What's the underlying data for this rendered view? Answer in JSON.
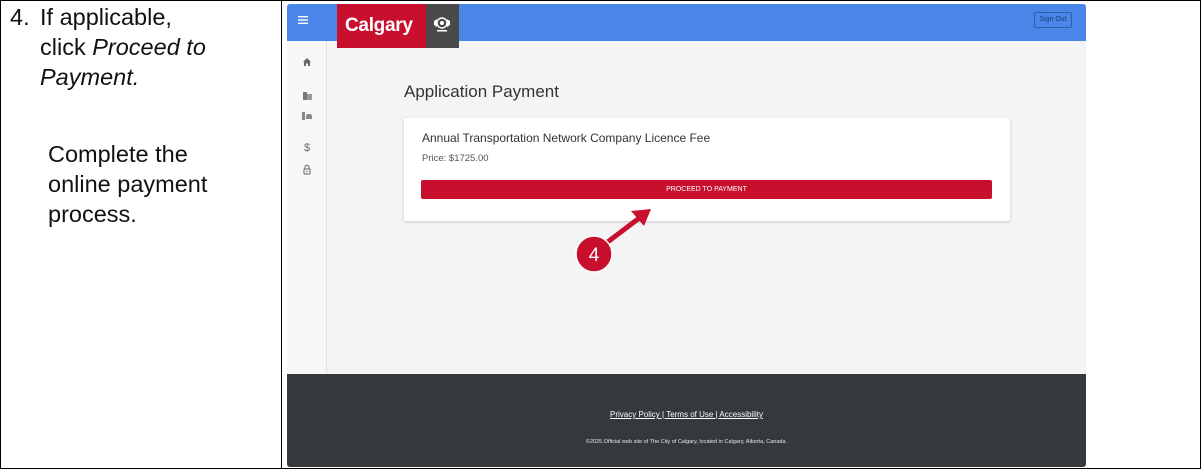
{
  "instruction": {
    "step_number": "4.",
    "line1": "If applicable,",
    "line2_prefix": "click ",
    "line2_em": "Proceed to",
    "line3_em": "Payment.",
    "line4": "Complete the",
    "line5": "online payment",
    "line6": "process."
  },
  "app": {
    "brand": "Calgary",
    "sign_out": "Sign Out",
    "menu_icon": "hamburger-menu-icon",
    "sidebar_icons": [
      "home-icon",
      "building-icon",
      "vehicle-icon",
      "dollar-icon",
      "lock-icon"
    ]
  },
  "main": {
    "page_title": "Application Payment",
    "card_title": "Annual Transportation Network Company Licence Fee",
    "price": "Price: $1725.00",
    "pay_button": "PROCEED TO PAYMENT"
  },
  "callout": {
    "number": "4",
    "color": "#c8102e"
  },
  "footer": {
    "privacy": "Privacy Policy",
    "sep1": " | ",
    "terms": "Terms of Use",
    "sep2": " | ",
    "accessibility": "Accessibility",
    "copyright": "©2025.Official web site of The City of Calgary, located in Calgary, Alberta, Canada."
  },
  "colors": {
    "topbar": "#4a86e8",
    "brand_red": "#c8102e",
    "footer": "#35383d"
  }
}
